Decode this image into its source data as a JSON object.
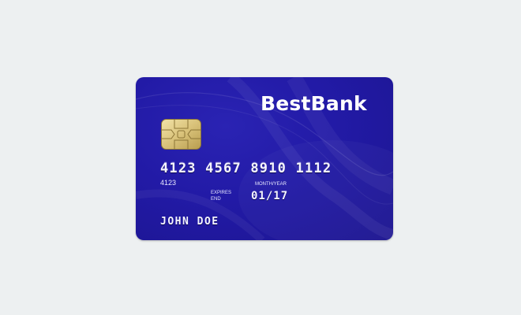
{
  "card": {
    "bank_name": "BestBank",
    "card_number": "4123 4567 8910 1112",
    "number_short": "4123",
    "expires_line1": "EXPIRES",
    "expires_line2": "END",
    "month_year_label": "MONTH/YEAR",
    "expiry_date": "01/17",
    "holder_name": "JOHN DOE",
    "icons": [
      "chip-icon"
    ],
    "colors": {
      "card_base": "#221aa6",
      "page_background": "#edf0f1",
      "chip_gold": "#d9c27a",
      "text": "#ffffff"
    }
  }
}
